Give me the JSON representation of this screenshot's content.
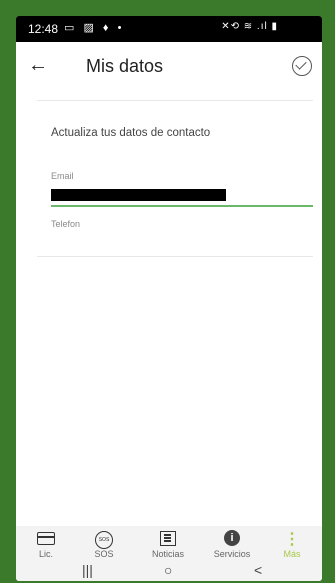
{
  "status_bar": {
    "time": "12:48",
    "left_icons": "▭ ▨ ♦ •",
    "right_icons": "✕⟲ ≋ .ıl ▮"
  },
  "app_bar": {
    "title": "Mis datos"
  },
  "card": {
    "title": "Actualiza tus datos de contacto",
    "email_label": "Email",
    "email_value_redacted": true,
    "phone_label": "Telefon"
  },
  "bottom_nav": {
    "items": [
      {
        "label": "Lic.",
        "icon": "card-icon"
      },
      {
        "label": "SOS",
        "icon": "sos-icon",
        "icon_text": "SOS"
      },
      {
        "label": "Noticias",
        "icon": "news-icon"
      },
      {
        "label": "Servicios",
        "icon": "info-icon",
        "icon_text": "i"
      },
      {
        "label": "Más",
        "icon": "more-icon",
        "icon_text": "⋮",
        "active": true
      }
    ]
  },
  "system_nav": {
    "recents": "|||",
    "home": "○",
    "back": "<"
  },
  "colors": {
    "accent": "#a8c94a",
    "input_underline": "#6bb86b",
    "frame": "#3a7a2a"
  }
}
